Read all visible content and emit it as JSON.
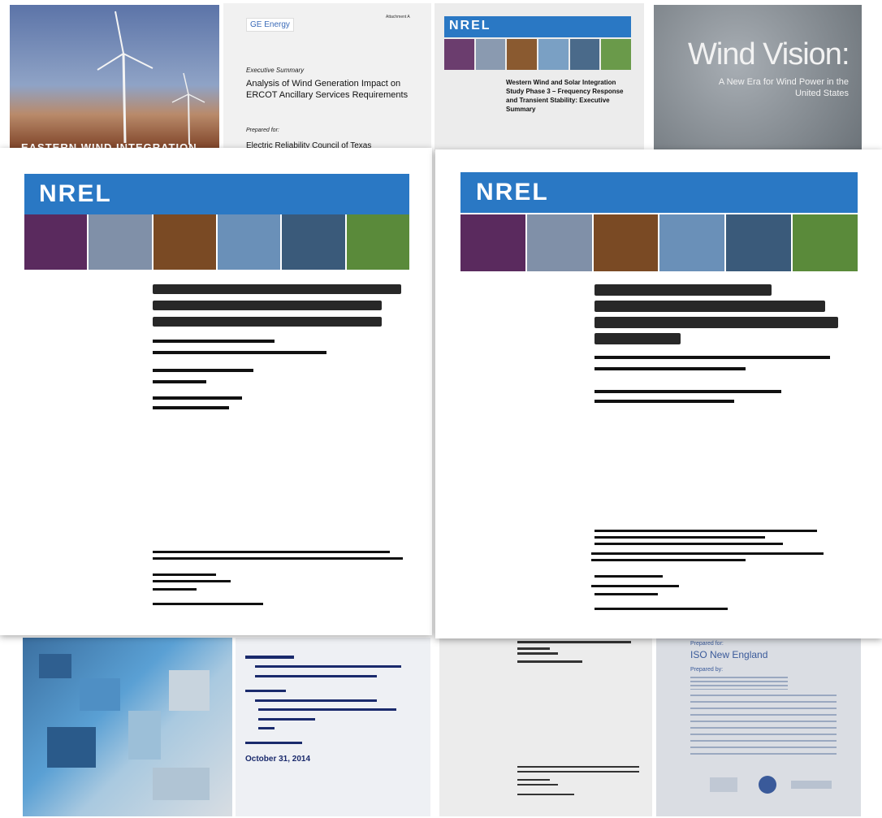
{
  "back_top": {
    "card1": {
      "text": "EASTERN WIND INTEGRATION"
    },
    "card2": {
      "brand": "GE Energy",
      "attachment": "Attachment A",
      "label": "Executive Summary",
      "title": "Analysis of Wind Generation Impact on ERCOT Ancillary Services Requirements",
      "prepared": "Prepared for:",
      "client": "Electric Reliability Council of Texas"
    },
    "card3": {
      "logo": "NREL",
      "title": "Western Wind and Solar Integration Study Phase 3 – Frequency Response and Transient Stability: Executive Summary"
    },
    "card4": {
      "title": "Wind Vision:",
      "subtitle": "A New Era for Wind Power in the United States"
    }
  },
  "front_left": {
    "logo": "NREL"
  },
  "front_right": {
    "logo": "NREL"
  },
  "back_bottom": {
    "card6": {
      "date": "October 31, 2014"
    },
    "card8": {
      "prepared_for": "Prepared for:",
      "client": "ISO New England",
      "prepared_by": "Prepared by:"
    }
  },
  "colors": {
    "nrel_blue": "#2a78c4",
    "navy_text": "#1a2a6c"
  }
}
